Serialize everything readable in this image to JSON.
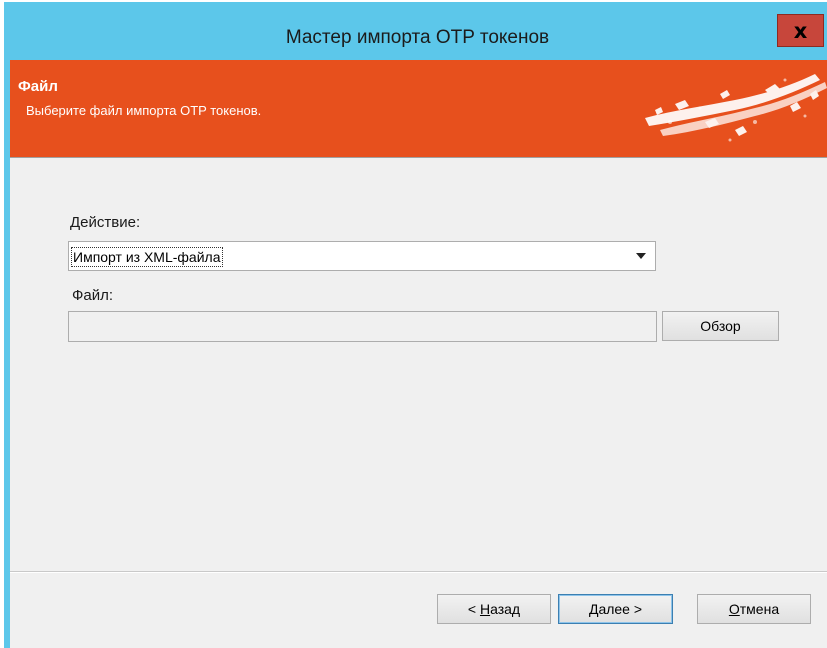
{
  "window": {
    "title": "Мастер импорта OTP токенов",
    "close_label": "x"
  },
  "banner": {
    "title": "Файл",
    "subtitle": "Выберите файл импорта OTP токенов.",
    "color": "#e7501d"
  },
  "form": {
    "action_label": "Действие:",
    "action_value": "Импорт из XML-файла",
    "file_label": "Файл:",
    "file_value": "",
    "browse_label": "Обзор"
  },
  "footer": {
    "back_prefix": "< ",
    "back_accel": "Н",
    "back_rest": "азад",
    "next_accel": "Д",
    "next_rest": "алее >",
    "cancel_accel": "О",
    "cancel_rest": "тмена"
  },
  "colors": {
    "titlebar": "#5cc7ea",
    "close_button": "#c7463b",
    "dialog_background": "#f0f0f0"
  }
}
